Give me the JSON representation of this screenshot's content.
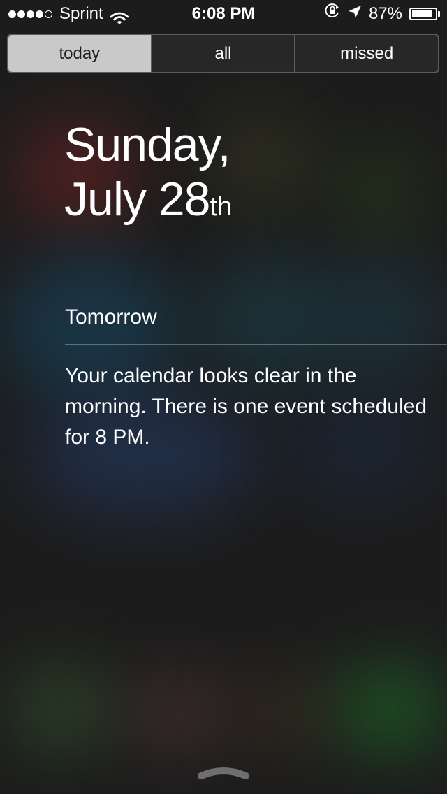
{
  "status_bar": {
    "signal_bars_filled": 4,
    "signal_bars_total": 5,
    "carrier": "Sprint",
    "time": "6:08 PM",
    "battery_percent": "87%",
    "battery_level": 0.87,
    "icons": [
      "wifi-icon",
      "rotation-lock-icon",
      "location-arrow-icon",
      "battery-icon"
    ]
  },
  "tabs": [
    {
      "label": "today",
      "active": true
    },
    {
      "label": "all",
      "active": false
    },
    {
      "label": "missed",
      "active": false
    }
  ],
  "date": {
    "weekday": "Sunday,",
    "month_day": "July 28",
    "ordinal_suffix": "th"
  },
  "tomorrow": {
    "label": "Tomorrow",
    "summary": "Your calendar looks clear in the morning. There is one event scheduled for 8 PM."
  },
  "colors": {
    "background": "#1c1c1c",
    "active_tab_bg": "#c9c9c9",
    "active_tab_text": "#1e1e1e",
    "text": "#ffffff"
  }
}
